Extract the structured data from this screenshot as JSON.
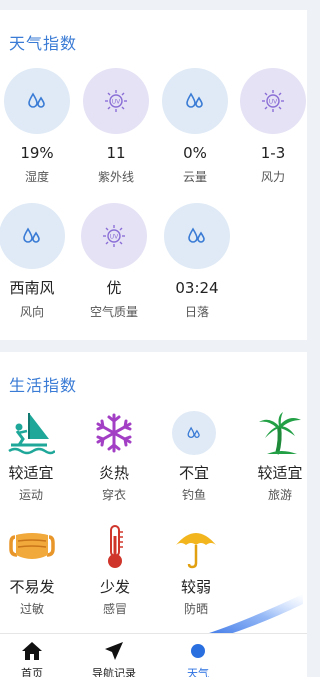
{
  "weather_index": {
    "title": "天气指数",
    "items": [
      {
        "value": "19%",
        "label": "湿度",
        "icon": "water-drops-icon"
      },
      {
        "value": "11",
        "label": "紫外线",
        "icon": "uv-sun-icon"
      },
      {
        "value": "0%",
        "label": "云量",
        "icon": "water-drops-icon"
      },
      {
        "value": "1-3",
        "label": "风力",
        "icon": "uv-sun-icon"
      },
      {
        "value": "西南风",
        "label": "风向",
        "icon": "water-drops-icon"
      },
      {
        "value": "优",
        "label": "空气质量",
        "icon": "uv-sun-icon"
      },
      {
        "value": "03:24",
        "label": "日落",
        "icon": "water-drops-icon"
      }
    ],
    "uv_badge": "UV"
  },
  "life_index": {
    "title": "生活指数",
    "items": [
      {
        "value": "较适宜",
        "label": "运动",
        "icon": "windsurfing-icon"
      },
      {
        "value": "炎热",
        "label": "穿衣",
        "icon": "snowflake-icon"
      },
      {
        "value": "不宜",
        "label": "钓鱼",
        "icon": "water-drops-icon"
      },
      {
        "value": "较适宜",
        "label": "旅游",
        "icon": "palm-tree-icon"
      },
      {
        "value": "不易发",
        "label": "过敏",
        "icon": "face-mask-icon"
      },
      {
        "value": "少发",
        "label": "感冒",
        "icon": "thermometer-icon"
      },
      {
        "value": "较弱",
        "label": "防晒",
        "icon": "umbrella-icon"
      }
    ]
  },
  "navbar": {
    "items": [
      {
        "label": "首页",
        "icon": "home-icon"
      },
      {
        "label": "导航记录",
        "icon": "navigation-arrow-icon"
      },
      {
        "label": "天气",
        "icon": "weather-icon"
      }
    ]
  },
  "colors": {
    "accent": "#3a7bd5",
    "circle_blue": "#dfeaf6",
    "circle_purple": "#e6e2f5",
    "uv_purple": "#8a6fd6",
    "drop_blue": "#3a7bd5"
  }
}
